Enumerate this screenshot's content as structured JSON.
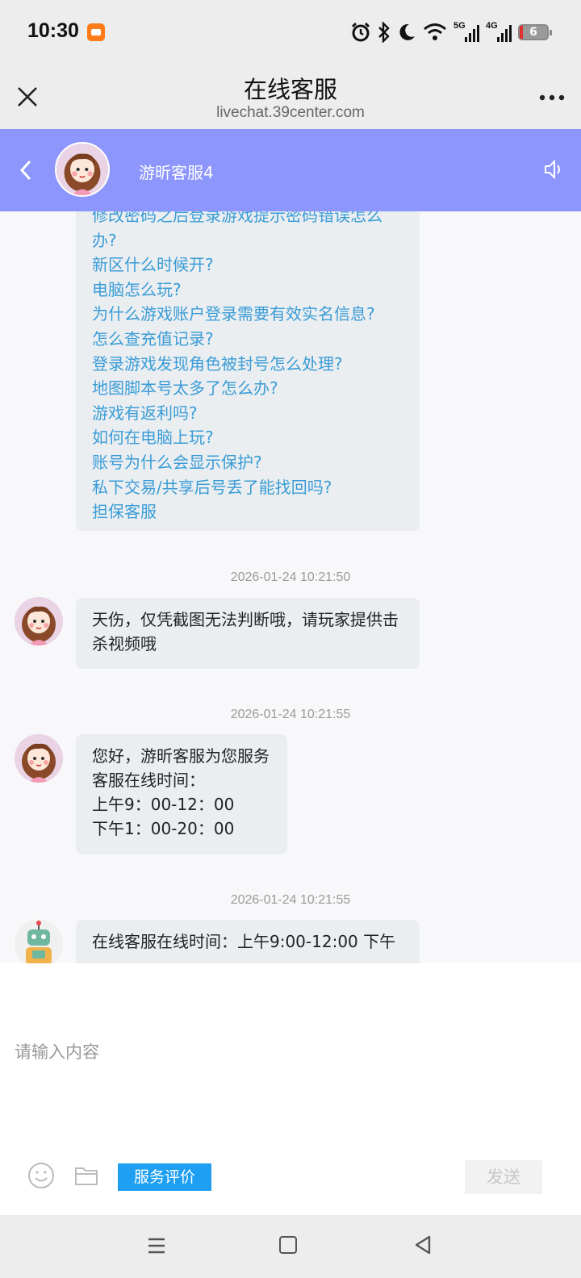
{
  "status_bar": {
    "time": "10:30",
    "battery": "6",
    "net1": "5G",
    "net2": "4G",
    "icons": [
      "app-notification-icon",
      "alarm-icon",
      "bluetooth-icon",
      "moon-icon",
      "wifi-icon",
      "signal-5g-icon",
      "signal-4g-icon",
      "battery-icon"
    ]
  },
  "browser": {
    "title": "在线客服",
    "url": "livechat.39center.com"
  },
  "chat_header": {
    "agent_name": "游昕客服4",
    "bg_color": "#8d96fc"
  },
  "faq_links": [
    "修改密码之后登录游戏提示密码错误怎么",
    "办?",
    "新区什么时候开?",
    "电脑怎么玩?",
    "为什么游戏账户登录需要有效实名信息?",
    "怎么查充值记录?",
    "登录游戏发现角色被封号怎么处理?",
    "地图脚本号太多了怎么办?",
    "游戏有返利吗?",
    "如何在电脑上玩?",
    "账号为什么会显示保护?",
    "私下交易/共享后号丢了能找回吗?",
    "担保客服"
  ],
  "messages": [
    {
      "timestamp": "2026-01-24 10:21:50",
      "lines": [
        "天伤，仅凭截图无法判断哦，请玩家提供击",
        "杀视频哦"
      ]
    },
    {
      "timestamp": "2026-01-24 10:21:55",
      "lines": [
        "您好，游昕客服为您服务",
        "客服在线时间：",
        "上午9：00-12：00",
        "下午1：00-20：00"
      ]
    },
    {
      "timestamp": "2026-01-24 10:21:55",
      "lines": [
        "在线客服在线时间：上午9:00-12:00 下午"
      ]
    }
  ],
  "input": {
    "placeholder": "请输入内容",
    "value": ""
  },
  "toolbar": {
    "rate_label": "服务评价",
    "send_label": "发送",
    "accent": "#1e9ff2"
  },
  "link_color": "#3a9cd6"
}
